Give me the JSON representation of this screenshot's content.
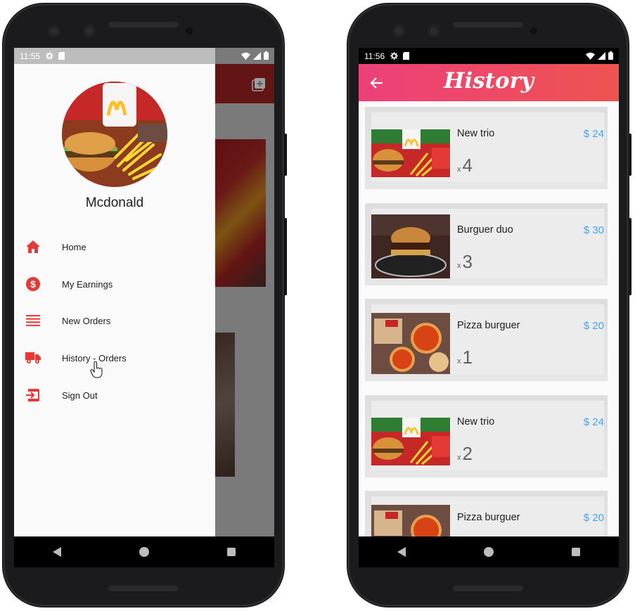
{
  "left_screen": {
    "status": {
      "time": "11:55"
    },
    "drawer": {
      "name": "Mcdonald",
      "menu": [
        {
          "label": "Home",
          "icon": "home-icon"
        },
        {
          "label": "My Earnings",
          "icon": "dollar-icon"
        },
        {
          "label": "New Orders",
          "icon": "list-icon"
        },
        {
          "label": "History - Orders",
          "icon": "truck-icon"
        },
        {
          "label": "Sign Out",
          "icon": "sign-out-icon"
        }
      ]
    }
  },
  "right_screen": {
    "status": {
      "time": "11:56"
    },
    "appbar": {
      "title": "History"
    },
    "orders": [
      {
        "name": "New trio",
        "price": "$ 24",
        "qty_prefix": "x",
        "qty": "4"
      },
      {
        "name": "Burguer duo",
        "price": "$ 30",
        "qty_prefix": "x",
        "qty": "3"
      },
      {
        "name": "Pizza burguer",
        "price": "$ 20",
        "qty_prefix": "x",
        "qty": "1"
      },
      {
        "name": "New trio",
        "price": "$ 24",
        "qty_prefix": "x",
        "qty": "2"
      },
      {
        "name": "Pizza burguer",
        "price": "$ 20",
        "qty_prefix": "x",
        "qty": ""
      }
    ]
  },
  "colors": {
    "accent_red": "#e53935",
    "price_blue": "#42a5f5",
    "appbar_start": "#ec407a",
    "appbar_end": "#ef5350"
  }
}
